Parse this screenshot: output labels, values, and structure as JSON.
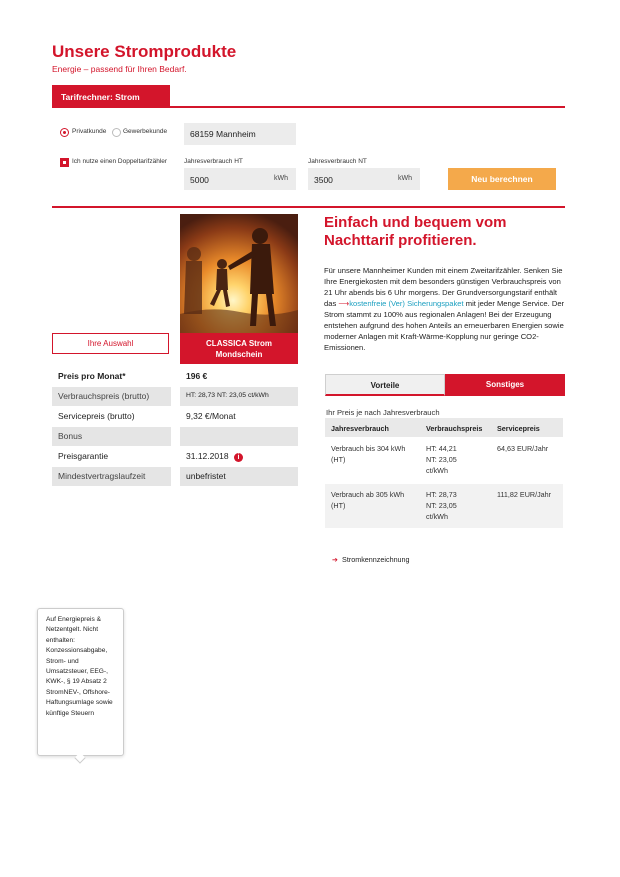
{
  "header": {
    "title": "Unsere Stromprodukte",
    "subtitle": "Energie – passend für Ihren Bedarf."
  },
  "calculator": {
    "tab_label": "Tarifrechner: Strom",
    "customer_private": "Privatkunde",
    "customer_business": "Gewerbekunde",
    "customer_selected": "Privatkunde",
    "location_value": "68159 Mannheim",
    "double_meter_label": "Ich nutze einen Doppeltarifzähler",
    "double_meter_checked": true,
    "ht_label": "Jahresverbrauch HT",
    "ht_value": "5000",
    "ht_unit": "kWh",
    "nt_label": "Jahresverbrauch NT",
    "nt_value": "3500",
    "nt_unit": "kWh",
    "recalc_button": "Neu berechnen"
  },
  "product": {
    "name_line1": "CLASSICA Strom",
    "name_line2": "Mondschein",
    "your_choice_button": "Ihre Auswahl",
    "rows": [
      {
        "label": "Preis pro Monat*",
        "value": "196 €"
      },
      {
        "label": "Verbrauchspreis (brutto)",
        "value": "HT: 28,73  NT: 23,05 ct/kWh"
      },
      {
        "label": "Servicepreis (brutto)",
        "value": "9,32 €/Monat"
      },
      {
        "label": "Bonus",
        "value": ""
      },
      {
        "label": "Preisgarantie",
        "value": "31.12.2018"
      },
      {
        "label": "Mindestvertragslaufzeit",
        "value": "unbefristet"
      }
    ]
  },
  "info": {
    "headline_line1": "Einfach und bequem vom",
    "headline_line2": "Nachttarif profitieren.",
    "desc_part1": "Für unsere Mannheimer Kunden mit einem Zweitarifzähler. Senken Sie Ihre Energiekosten mit dem besonders günstigen Verbrauchspreis von 21 Uhr abends bis 6 Uhr morgens. Der Grundversorgungstarif enthält das ",
    "desc_link": "kostenfreie (Ver) Sicherungspaket",
    "desc_part2": " mit jeder Menge Service. Der Strom stammt zu 100% aus regionalen Anlagen! Bei der Erzeugung entstehen aufgrund des hohen Anteils an erneuerbaren Energien sowie moderner Anlagen mit Kraft-Wärme-Kopplung nur geringe CO2-Emissionen.",
    "tab_advantages": "Vorteile",
    "tab_other": "Sonstiges",
    "price_caption": "Ihr Preis je nach Jahresverbrauch",
    "table": {
      "headers": [
        "Jahresverbrauch",
        "Verbrauchspreis",
        "Servicepreis"
      ],
      "rows": [
        {
          "consumption": "Verbrauch bis 304 kWh (HT)",
          "price_ht": "HT: 44,21",
          "price_nt": "NT: 23,05",
          "price_unit": "ct/kWh",
          "service": "64,63 EUR/Jahr"
        },
        {
          "consumption": "Verbrauch ab 305 kWh (HT)",
          "price_ht": "HT: 28,73",
          "price_nt": "NT: 23,05",
          "price_unit": "ct/kWh",
          "service": "111,82 EUR/Jahr"
        }
      ]
    },
    "label_link": "Stromkennzeichnung"
  },
  "tooltip": {
    "text": "Auf Energiepreis & Netzentgelt. Nicht enthalten: Konzessionsabgabe, Strom- und Umsatzsteuer, EEG-, KWK-, § 19 Absatz 2 StromNEV-, Offshore-Haftungsumlage sowie künftige Steuern"
  },
  "colors": {
    "brand_red": "#d3152b",
    "button_orange": "#f4a94b",
    "link_blue": "#1b9fc0",
    "field_gray": "#ececec"
  }
}
